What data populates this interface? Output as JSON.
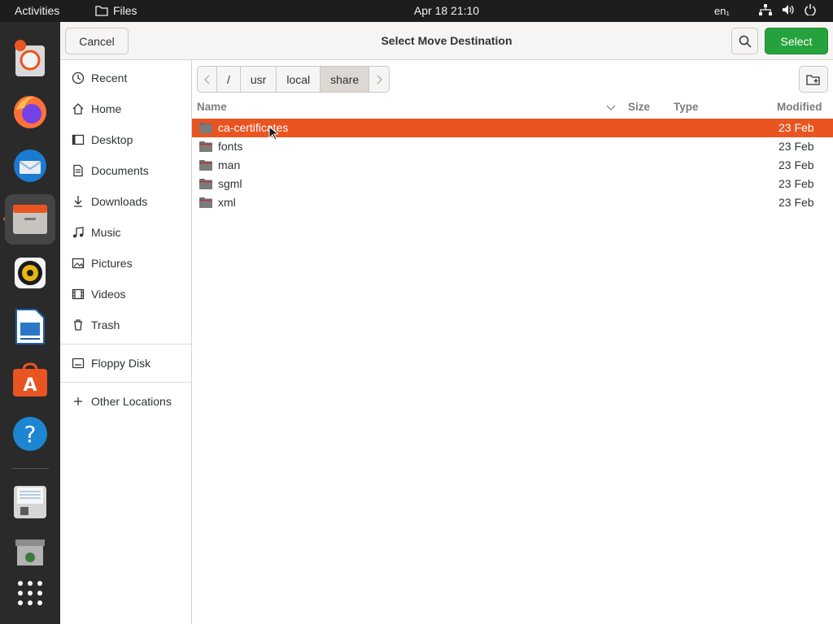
{
  "topbar": {
    "activities": "Activities",
    "app_name": "Files",
    "clock": "Apr 18  21:10",
    "lang": "en₁"
  },
  "dock": {
    "items": [
      "Help",
      "Firefox",
      "Thunderbird",
      "Files",
      "Rhythmbox",
      "LibreOffice Writer",
      "Ubuntu Software",
      "Help",
      "Floppy",
      "Trash",
      "Show Applications"
    ]
  },
  "dialog": {
    "title": "Select Move Destination",
    "cancel_label": "Cancel",
    "select_label": "Select"
  },
  "sidebar": {
    "items": [
      {
        "label": "Recent",
        "icon": "clock-icon"
      },
      {
        "label": "Home",
        "icon": "home-icon"
      },
      {
        "label": "Desktop",
        "icon": "desktop-icon"
      },
      {
        "label": "Documents",
        "icon": "documents-icon"
      },
      {
        "label": "Downloads",
        "icon": "download-icon"
      },
      {
        "label": "Music",
        "icon": "music-icon"
      },
      {
        "label": "Pictures",
        "icon": "pictures-icon"
      },
      {
        "label": "Videos",
        "icon": "videos-icon"
      },
      {
        "label": "Trash",
        "icon": "trash-icon"
      }
    ],
    "devices": [
      {
        "label": "Floppy Disk",
        "icon": "floppy-icon"
      }
    ],
    "other": {
      "label": "Other Locations",
      "icon": "plus-icon"
    }
  },
  "pathbar": {
    "segments": [
      "/",
      "usr",
      "local",
      "share"
    ],
    "current": "share"
  },
  "columns": {
    "name": "Name",
    "size": "Size",
    "type": "Type",
    "modified": "Modified"
  },
  "files": [
    {
      "name": "ca-certificates",
      "modified": "23 Feb",
      "selected": true
    },
    {
      "name": "fonts",
      "modified": "23 Feb",
      "selected": false
    },
    {
      "name": "man",
      "modified": "23 Feb",
      "selected": false
    },
    {
      "name": "sgml",
      "modified": "23 Feb",
      "selected": false
    },
    {
      "name": "xml",
      "modified": "23 Feb",
      "selected": false
    }
  ],
  "colors": {
    "accent": "#e95420",
    "select_button": "#26a23c",
    "topbar": "#1d1d1d",
    "dock": "#2a2a2a"
  }
}
